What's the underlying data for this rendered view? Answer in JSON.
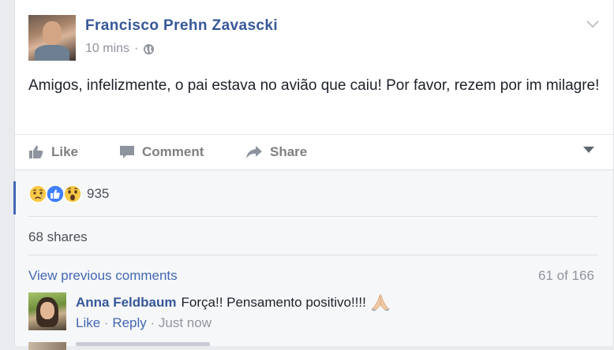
{
  "post": {
    "author": "Francisco Prehn Zavascki",
    "time": "10 mins",
    "separator": "·",
    "audience_icon": "globe-icon",
    "text": "Amigos, infelizmente, o pai estava no avião que caiu! Por favor, rezem por im milagre!"
  },
  "actions": {
    "like": "Like",
    "comment": "Comment",
    "share": "Share"
  },
  "reactions": {
    "icons": [
      "sad-reaction-icon",
      "like-reaction-icon",
      "wow-reaction-icon"
    ],
    "count": "935"
  },
  "shares": "68 shares",
  "comments": {
    "view_previous": "View previous comments",
    "count": "61 of 166",
    "items": [
      {
        "author": "Anna Feldbaum",
        "text": "Força!! Pensamento positivo!!!!",
        "emoji": "pray-icon",
        "like": "Like",
        "reply": "Reply",
        "time": "Just now"
      }
    ]
  },
  "colors": {
    "link": "#365899",
    "muted": "#90949c",
    "action_gray": "#7f7f7f",
    "accent": "#4267b2"
  }
}
